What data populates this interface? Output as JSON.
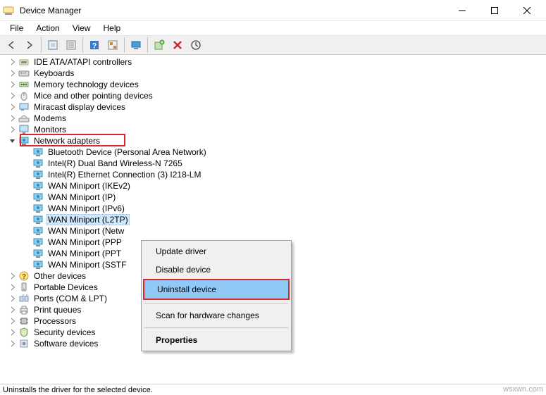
{
  "window": {
    "title": "Device Manager"
  },
  "menubar": [
    "File",
    "Action",
    "View",
    "Help"
  ],
  "toolbar": [
    {
      "name": "back-icon"
    },
    {
      "name": "forward-icon"
    },
    {
      "name": "show-hidden-icon"
    },
    {
      "name": "properties-icon"
    },
    {
      "name": "help-icon"
    },
    {
      "name": "action1-icon"
    },
    {
      "name": "scan-hardware-icon"
    },
    {
      "name": "add-device-icon"
    },
    {
      "name": "remove-icon"
    },
    {
      "name": "update-icon"
    }
  ],
  "tree": [
    {
      "level": 1,
      "expanded": false,
      "icon": "ide-icon",
      "label": "IDE ATA/ATAPI controllers"
    },
    {
      "level": 1,
      "expanded": false,
      "icon": "keyboard-icon",
      "label": "Keyboards"
    },
    {
      "level": 1,
      "expanded": false,
      "icon": "memory-icon",
      "label": "Memory technology devices"
    },
    {
      "level": 1,
      "expanded": false,
      "icon": "mouse-icon",
      "label": "Mice and other pointing devices"
    },
    {
      "level": 1,
      "expanded": false,
      "icon": "miracast-icon",
      "label": "Miracast display devices"
    },
    {
      "level": 1,
      "expanded": false,
      "icon": "modem-icon",
      "label": "Modems"
    },
    {
      "level": 1,
      "expanded": false,
      "icon": "monitor-icon",
      "label": "Monitors"
    },
    {
      "level": 1,
      "expanded": true,
      "icon": "network-icon",
      "label": "Network adapters",
      "highlight": "category"
    },
    {
      "level": 2,
      "expanded": null,
      "icon": "network-icon",
      "label": "Bluetooth Device (Personal Area Network)"
    },
    {
      "level": 2,
      "expanded": null,
      "icon": "network-icon",
      "label": "Intel(R) Dual Band Wireless-N 7265"
    },
    {
      "level": 2,
      "expanded": null,
      "icon": "network-icon",
      "label": "Intel(R) Ethernet Connection (3) I218-LM"
    },
    {
      "level": 2,
      "expanded": null,
      "icon": "network-icon",
      "label": "WAN Miniport (IKEv2)"
    },
    {
      "level": 2,
      "expanded": null,
      "icon": "network-icon",
      "label": "WAN Miniport (IP)"
    },
    {
      "level": 2,
      "expanded": null,
      "icon": "network-icon",
      "label": "WAN Miniport (IPv6)"
    },
    {
      "level": 2,
      "expanded": null,
      "icon": "network-icon",
      "label": "WAN Miniport (L2TP)",
      "selected": true
    },
    {
      "level": 2,
      "expanded": null,
      "icon": "network-icon",
      "label": "WAN Miniport (Network Monitor)",
      "truncate": "WAN Miniport (Netw"
    },
    {
      "level": 2,
      "expanded": null,
      "icon": "network-icon",
      "label": "WAN Miniport (PPPOE)",
      "truncate": "WAN Miniport (PPP"
    },
    {
      "level": 2,
      "expanded": null,
      "icon": "network-icon",
      "label": "WAN Miniport (PPTP)",
      "truncate": "WAN Miniport (PPT"
    },
    {
      "level": 2,
      "expanded": null,
      "icon": "network-icon",
      "label": "WAN Miniport (SSTP)",
      "truncate": "WAN Miniport (SSTF"
    },
    {
      "level": 1,
      "expanded": false,
      "icon": "other-icon",
      "label": "Other devices"
    },
    {
      "level": 1,
      "expanded": false,
      "icon": "portable-icon",
      "label": "Portable Devices"
    },
    {
      "level": 1,
      "expanded": false,
      "icon": "ports-icon",
      "label": "Ports (COM & LPT)"
    },
    {
      "level": 1,
      "expanded": false,
      "icon": "printer-icon",
      "label": "Print queues"
    },
    {
      "level": 1,
      "expanded": false,
      "icon": "processor-icon",
      "label": "Processors"
    },
    {
      "level": 1,
      "expanded": false,
      "icon": "security-icon",
      "label": "Security devices"
    },
    {
      "level": 1,
      "expanded": false,
      "icon": "software-icon",
      "label": "Software devices"
    }
  ],
  "context_menu": {
    "items": [
      {
        "label": "Update driver",
        "type": "item"
      },
      {
        "label": "Disable device",
        "type": "item"
      },
      {
        "label": "Uninstall device",
        "type": "item",
        "highlighted": true,
        "annotated": true
      },
      {
        "type": "sep"
      },
      {
        "label": "Scan for hardware changes",
        "type": "item"
      },
      {
        "type": "sep"
      },
      {
        "label": "Properties",
        "type": "item",
        "bold": true
      }
    ]
  },
  "statusbar": {
    "text": "Uninstalls the driver for the selected device."
  },
  "watermark": "wsxwn.com"
}
